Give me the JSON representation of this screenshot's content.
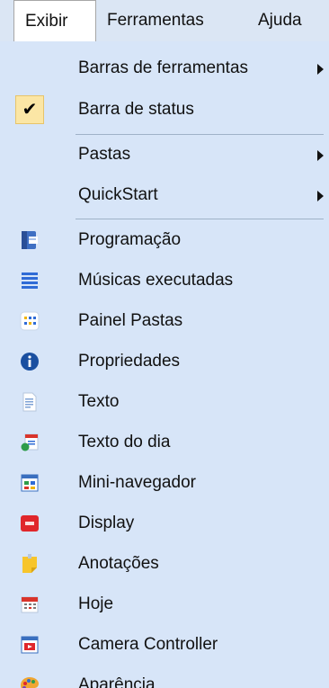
{
  "menubar": {
    "items": [
      {
        "label": "Exibir"
      },
      {
        "label": "Ferramentas"
      },
      {
        "label": "Ajuda"
      }
    ]
  },
  "menu": {
    "items": [
      {
        "label": "Barras de ferramentas",
        "submenu": true
      },
      {
        "label": "Barra de status",
        "checked": true,
        "check_glyph": "✔"
      },
      {
        "label": "Pastas",
        "submenu": true
      },
      {
        "label": "QuickStart",
        "submenu": true
      },
      {
        "label": "Programação",
        "icon": "schedule-book-icon"
      },
      {
        "label": "Músicas executadas",
        "icon": "list-lines-icon"
      },
      {
        "label": "Painel Pastas",
        "icon": "folder-grid-icon"
      },
      {
        "label": "Propriedades",
        "icon": "info-icon"
      },
      {
        "label": "Texto",
        "icon": "document-icon"
      },
      {
        "label": "Texto do dia",
        "icon": "calendar-text-icon"
      },
      {
        "label": "Mini-navegador",
        "icon": "mini-browser-icon"
      },
      {
        "label": "Display",
        "icon": "display-icon"
      },
      {
        "label": "Anotações",
        "icon": "sticky-note-icon"
      },
      {
        "label": "Hoje",
        "icon": "today-calendar-icon"
      },
      {
        "label": "Camera Controller",
        "icon": "camera-controller-icon"
      },
      {
        "label": "Aparência",
        "icon": "palette-icon"
      }
    ]
  },
  "colors": {
    "menu_bg": "#d7e5f8",
    "check_bg": "#fbe6a5",
    "separator": "#9fb2c8"
  }
}
